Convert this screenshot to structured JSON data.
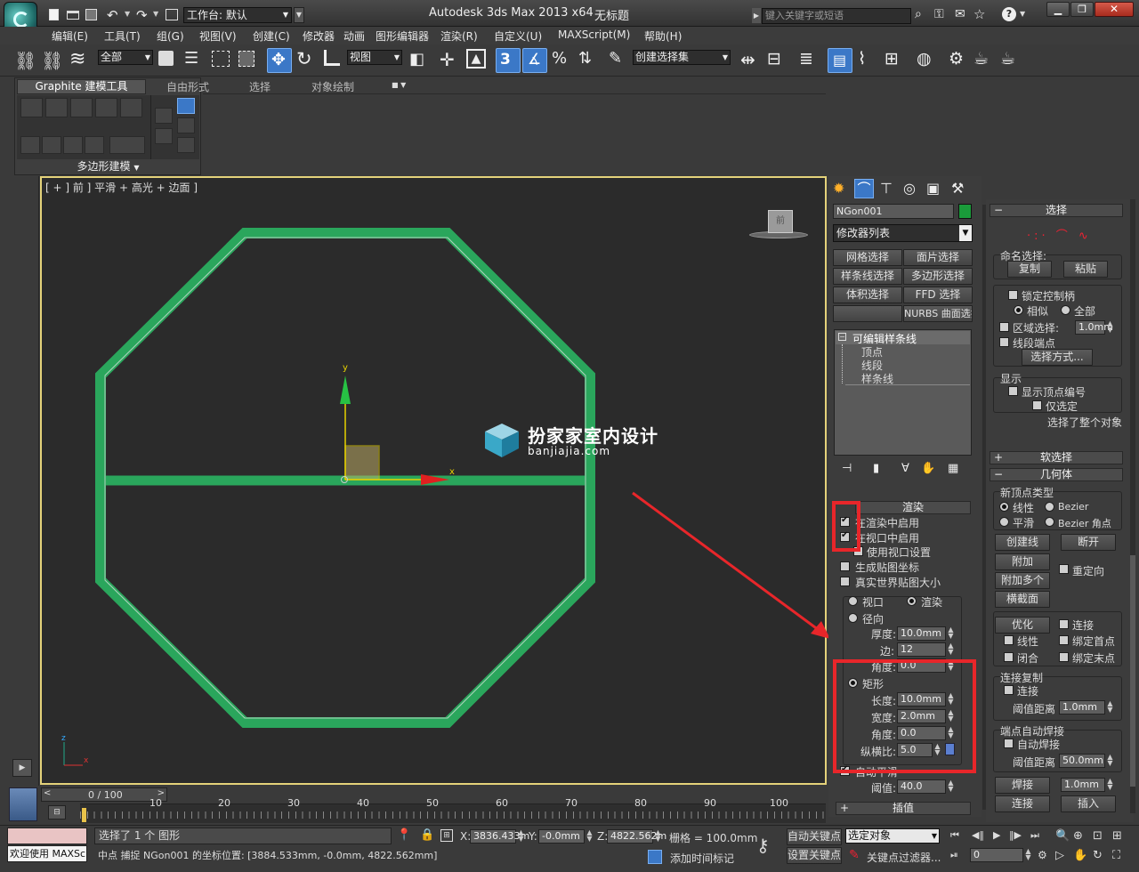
{
  "titlebar": {
    "workspace_label": "工作台: 默认",
    "title": "Autodesk 3ds Max  2013 x64",
    "doc": "无标题",
    "search_placeholder": "键入关键字或短语"
  },
  "menubar": [
    "编辑(E)",
    "工具(T)",
    "组(G)",
    "视图(V)",
    "创建(C)",
    "修改器",
    "动画",
    "图形编辑器",
    "渲染(R)",
    "自定义(U)",
    "MAXScript(M)",
    "帮助(H)"
  ],
  "toolbar": {
    "filter_value": "全部",
    "refcoord_value": "视图",
    "named_sel_value": "创建选择集",
    "snap_label": "3"
  },
  "ribbon": {
    "tabs": [
      "Graphite 建模工具",
      "自由形式",
      "选择",
      "对象绘制"
    ],
    "panel_label": "多边形建模"
  },
  "viewport": {
    "label": "[ + ] 前 ] 平滑 + 高光 + 边面 ]",
    "watermark_cn": "扮家家室内设计",
    "watermark_en": "banjiajia.com",
    "axis_x": "x",
    "axis_y": "y",
    "cube_label": "前"
  },
  "command_panel": {
    "object_name": "NGon001",
    "object_color": "#1a9b3a",
    "modifier_list": "修改器列表",
    "modifier_buttons": [
      "网格选择",
      "面片选择",
      "样条线选择",
      "多边形选择",
      "体积选择",
      "FFD 选择",
      "",
      "NURBS 曲面选择"
    ],
    "stack": [
      "可编辑样条线",
      "顶点",
      "线段",
      "样条线"
    ],
    "render_rollout": {
      "title": "渲染",
      "enable_render": "在渲染中启用",
      "enable_viewport": "在视口中启用",
      "use_viewport": "使用视口设置",
      "gen_map": "生成贴图坐标",
      "real_world": "真实世界贴图大小",
      "viewport_radio": "视口",
      "render_radio": "渲染",
      "radial": "径向",
      "thickness_label": "厚度:",
      "thickness": "10.0mm",
      "sides_label": "边:",
      "sides": "12",
      "angle_label": "角度:",
      "angle": "0.0",
      "rect": "矩形",
      "length_label": "长度:",
      "length": "10.0mm",
      "width_label": "宽度:",
      "width": "2.0mm",
      "rect_angle_label": "角度:",
      "rect_angle": "0.0",
      "aspect_label": "纵横比:",
      "aspect": "5.0",
      "auto_smooth": "自动平滑",
      "threshold_label": "阈值:",
      "threshold": "40.0"
    },
    "interp_title": "插值"
  },
  "right_panel": {
    "select_title": "选择",
    "named_sel": "命名选择:",
    "copy": "复制",
    "paste": "粘贴",
    "lock_handles": "锁定控制柄",
    "alike": "相似",
    "all": "全部",
    "area_sel": "区域选择:",
    "area_val": "1.0mm",
    "seg_end": "线段端点",
    "sel_by": "选择方式...",
    "display": "显示",
    "show_vnum": "显示顶点编号",
    "only_sel": "仅选定",
    "sel_info": "选择了整个对象",
    "soft_sel": "软选择",
    "geometry": "几何体",
    "new_vtype": "新顶点类型",
    "linear": "线性",
    "bezier": "Bezier",
    "smooth": "平滑",
    "bezier_corner": "Bezier 角点",
    "create_line": "创建线",
    "break": "断开",
    "attach": "附加",
    "attach_mult": "附加多个",
    "reorient": "重定向",
    "cross_section": "横截面",
    "refine": "优化",
    "connect": "连接",
    "linear2": "线性",
    "bind_first": "绑定首点",
    "closed": "闭合",
    "bind_last": "绑定末点",
    "connect_copy": "连接复制",
    "connect2": "连接",
    "threshold_dist": "阈值距离",
    "threshold_val": "1.0mm",
    "end_weld": "端点自动焊接",
    "auto_weld": "自动焊接",
    "threshold_dist2": "阈值距离",
    "weld_val": "50.0mm",
    "weld": "焊接",
    "weld_spin": "1.0mm",
    "connect3": "连接",
    "insert": "插入"
  },
  "timeline": {
    "frame_label": "0 / 100",
    "ticks": [
      "10",
      "20",
      "30",
      "40",
      "50",
      "60",
      "70",
      "80",
      "90",
      "100"
    ]
  },
  "status": {
    "welcome": "欢迎使用 MAXSc",
    "selected": "选择了 1 个 图形",
    "prompt": "中点 捕捉 NGon001 的坐标位置: [3884.533mm, -0.0mm, 4822.562mm]",
    "x_label": "X:",
    "x": "3836.433m",
    "y_label": "Y:",
    "y": "-0.0mm",
    "z_label": "Z:",
    "z": "4822.562m",
    "grid": "栅格 = 100.0mm",
    "add_time_tag": "添加时间标记",
    "auto_key": "自动关键点",
    "set_key": "设置关键点",
    "key_mode": "选定对象",
    "key_filters": "关键点过滤器...",
    "frame_input": "0"
  },
  "colors": {
    "shape_green": "#2aa65c",
    "highlight_red": "#e8262a",
    "active_blue": "#3b78c7"
  }
}
